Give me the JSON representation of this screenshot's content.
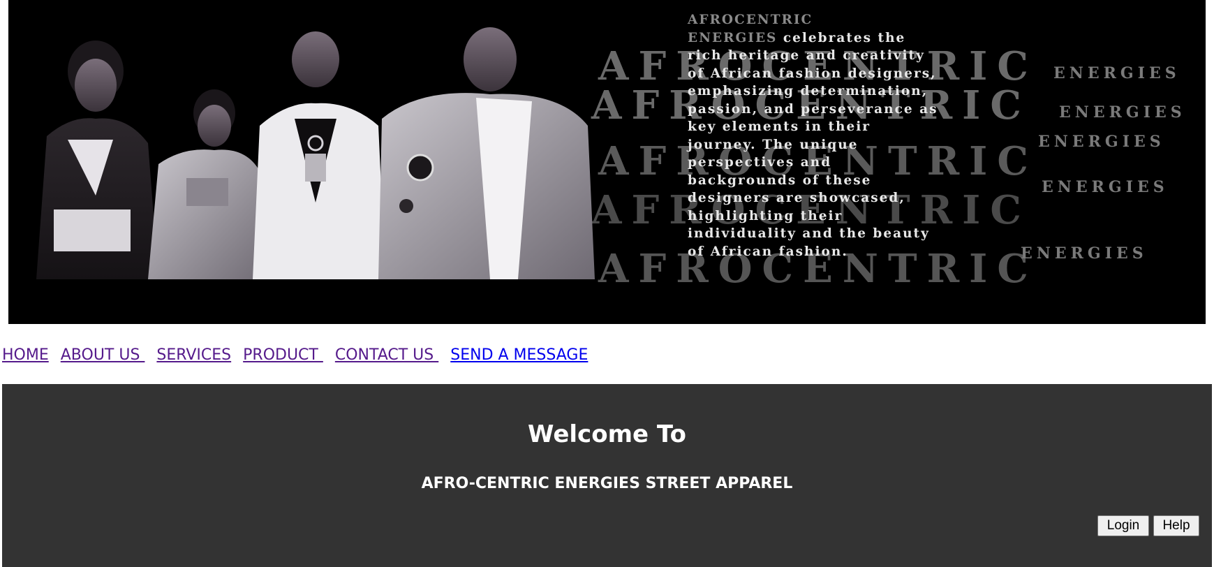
{
  "banner": {
    "background_words": [
      "AFROCENTRIC",
      "AFROCENTRIC",
      "AFROCENTRIC",
      "AFROCENTRIC",
      "AFROCENTRIC"
    ],
    "side_words": [
      "ENERGIES",
      "ENERGIES",
      "ENERGIES",
      "ENERGIES",
      "ENERGIES"
    ],
    "copy_heading_line1": "AFROCENTRIC",
    "copy_heading_line2": "ENERGIES",
    "copy_text": " celebrates the rich heritage and creativity of African fashion designers, emphasizing determination, passion, and perseverance as key elements in their journey. The unique perspectives and backgrounds of these designers are showcased, highlighting their individuality and the beauty of African fashion."
  },
  "nav": {
    "items": [
      {
        "label": "HOME",
        "visited": true
      },
      {
        "label": "ABOUT US ",
        "visited": true
      },
      {
        "label": "SERVICES",
        "visited": true
      },
      {
        "label": "PRODUCT ",
        "visited": true
      },
      {
        "label": "CONTACT US ",
        "visited": true
      },
      {
        "label": "SEND A MESSAGE",
        "visited": false
      }
    ]
  },
  "welcome": {
    "title": "Welcome To",
    "subtitle": "AFRO-CENTRIC ENERGIES STREET APPAREL",
    "login_label": "Login",
    "help_label": "Help"
  },
  "colors": {
    "banner_bg": "#000000",
    "welcome_bg": "#333333",
    "visited_link": "#551a8b",
    "unvisited_link": "#0000ee"
  }
}
